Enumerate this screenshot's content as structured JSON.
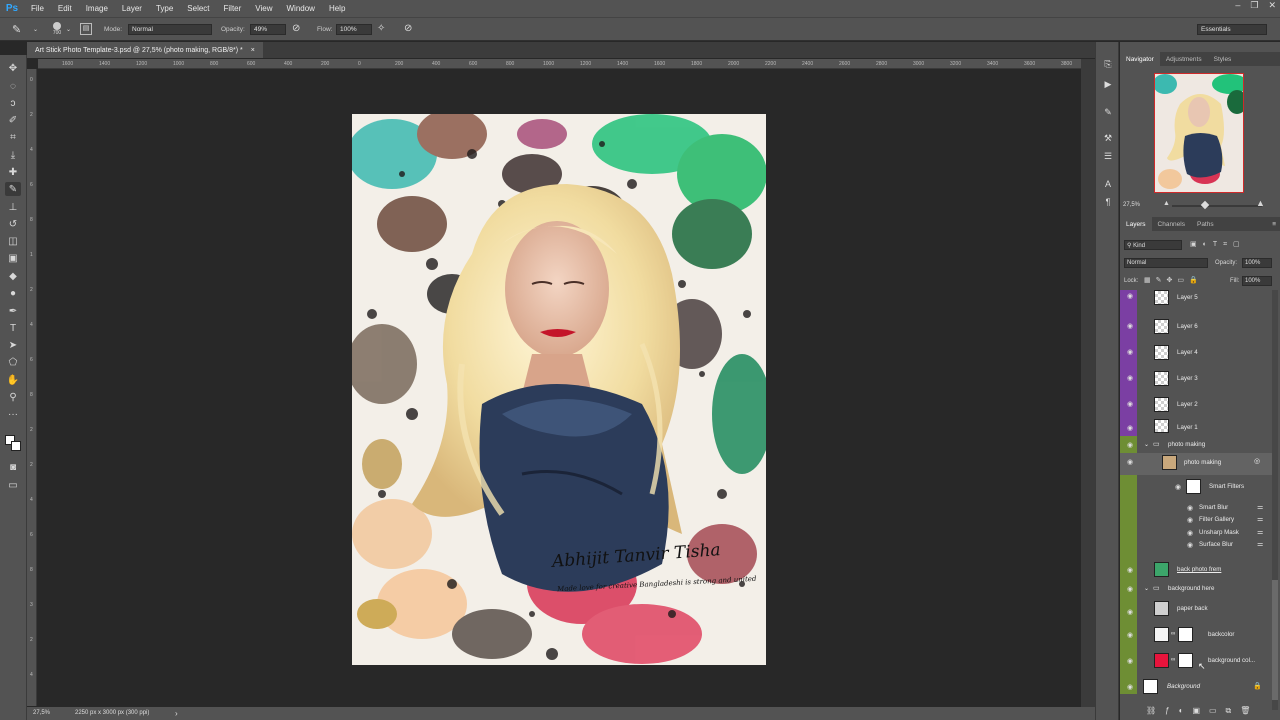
{
  "app": {
    "logo": "Ps"
  },
  "menu": [
    "File",
    "Edit",
    "Image",
    "Layer",
    "Type",
    "Select",
    "Filter",
    "View",
    "Window",
    "Help"
  ],
  "window_controls": [
    "–",
    "❐",
    "✕"
  ],
  "options": {
    "brush_size": "700",
    "mode_label": "Mode:",
    "mode_value": "Normal",
    "opacity_label": "Opacity:",
    "opacity_value": "49%",
    "flow_label": "Flow:",
    "flow_value": "100%",
    "workspace": "Essentials"
  },
  "document": {
    "tab_title": "Art Stick Photo Template-3.psd @ 27,5% (photo making, RGB/8*) *",
    "close": "×",
    "status_zoom": "27,5%",
    "status_info": "2250 px x 3000 px (300 ppi)",
    "status_arrow": "›",
    "artwork_script_line1": "Abhijit Tanvir Tisha",
    "artwork_script_line2": "Made love for creative Bangladeshi is strong and united"
  },
  "ruler_top": [
    "1600",
    "1400",
    "1200",
    "1000",
    "800",
    "600",
    "400",
    "200",
    "0",
    "200",
    "400",
    "600",
    "800",
    "1000",
    "1200",
    "1400",
    "1600",
    "1800",
    "2000",
    "2200",
    "2400",
    "2600",
    "2800",
    "3000",
    "3200",
    "3400",
    "3600",
    "3800"
  ],
  "ruler_left": [
    "0",
    "2",
    "4",
    "6",
    "8",
    "1",
    "2",
    "4",
    "6",
    "8",
    "2",
    "2",
    "4",
    "6",
    "8",
    "3",
    "2",
    "4"
  ],
  "navigator": {
    "tabs": [
      "Navigator",
      "Adjustments",
      "Styles"
    ],
    "zoom": "27,5%"
  },
  "layers_panel": {
    "tabs": [
      "Layers",
      "Channels",
      "Paths"
    ],
    "filter_kind": "Kind",
    "blend_mode": "Normal",
    "opacity_label": "Opacity:",
    "opacity_value": "100%",
    "lock_label": "Lock:",
    "fill_label": "Fill:",
    "fill_value": "100%",
    "layers": [
      {
        "name": "Layer 5"
      },
      {
        "name": "Layer 6"
      },
      {
        "name": "Layer 4"
      },
      {
        "name": "Layer 3"
      },
      {
        "name": "Layer 2"
      },
      {
        "name": "Layer 1"
      },
      {
        "name": "photo making"
      },
      {
        "name": "photo making"
      },
      {
        "name": "Smart Filters"
      },
      {
        "name": "Smart Blur"
      },
      {
        "name": "Filter Gallery"
      },
      {
        "name": "Unsharp Mask"
      },
      {
        "name": "Surface Blur"
      },
      {
        "name": "back photo frem"
      },
      {
        "name": "background here"
      },
      {
        "name": "paper back"
      },
      {
        "name": "backcolor"
      },
      {
        "name": "background col..."
      },
      {
        "name": "Background"
      }
    ],
    "colors": {
      "purple": "#7b3fa3",
      "green": "#6e8e34",
      "red_fill": "#e8143c"
    }
  },
  "tools": [
    "move",
    "marquee",
    "lasso",
    "quick-select",
    "crop",
    "eyedropper",
    "healing",
    "brush",
    "clone",
    "history",
    "eraser",
    "gradient",
    "blur",
    "dodge",
    "pen",
    "type",
    "path-select",
    "shape",
    "hand",
    "zoom",
    "more"
  ]
}
